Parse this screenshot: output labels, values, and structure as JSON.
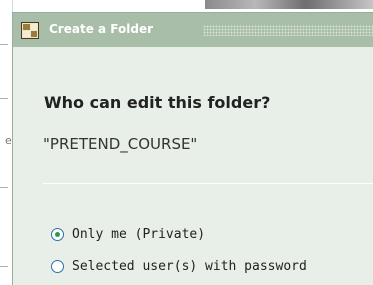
{
  "dialog": {
    "title": "Create a Folder",
    "icon": "folder-window-icon"
  },
  "content": {
    "heading": "Who can edit this folder?",
    "folder_name": "\"PRETEND_COURSE\""
  },
  "permissions": {
    "selected": "private",
    "options": [
      {
        "id": "private",
        "label": "Only me (Private)",
        "checked": true
      },
      {
        "id": "password",
        "label": "Selected user(s) with password",
        "checked": false
      }
    ]
  },
  "colors": {
    "titlebar": "#a8bea9",
    "dialog_bg": "#e8efe8",
    "radio_dot": "#2a9a4a",
    "radio_ring": "#2f6fa8"
  }
}
